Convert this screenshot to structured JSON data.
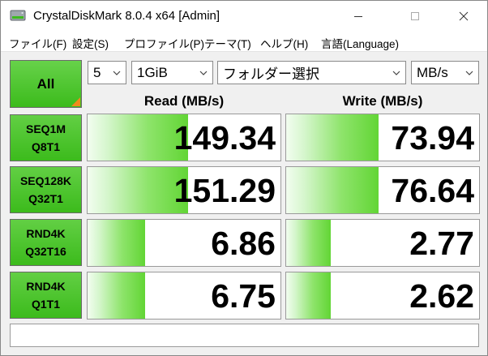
{
  "window": {
    "title": "CrystalDiskMark 8.0.4 x64 [Admin]"
  },
  "menu": {
    "items": [
      "ファイル(F)",
      "設定(S)",
      "プロファイル(P)",
      "テーマ(T)",
      "ヘルプ(H)",
      "言語(Language)"
    ]
  },
  "controls": {
    "all_label": "All",
    "test_count": "5",
    "test_size": "1GiB",
    "target": "フォルダー選択",
    "unit": "MB/s"
  },
  "headers": {
    "read": "Read (MB/s)",
    "write": "Write (MB/s)"
  },
  "colors": {
    "accent_green": "#3cbb1c",
    "corner_orange": "#f08a1c"
  },
  "tests": [
    {
      "line1": "SEQ1M",
      "line2": "Q8T1",
      "read": "149.34",
      "write": "73.94",
      "read_fill": 0.52,
      "write_fill": 0.48
    },
    {
      "line1": "SEQ128K",
      "line2": "Q32T1",
      "read": "151.29",
      "write": "76.64",
      "read_fill": 0.52,
      "write_fill": 0.48
    },
    {
      "line1": "RND4K",
      "line2": "Q32T16",
      "read": "6.86",
      "write": "2.77",
      "read_fill": 0.3,
      "write_fill": 0.23
    },
    {
      "line1": "RND4K",
      "line2": "Q1T1",
      "read": "6.75",
      "write": "2.62",
      "read_fill": 0.3,
      "write_fill": 0.23
    }
  ],
  "comment": {
    "value": ""
  }
}
